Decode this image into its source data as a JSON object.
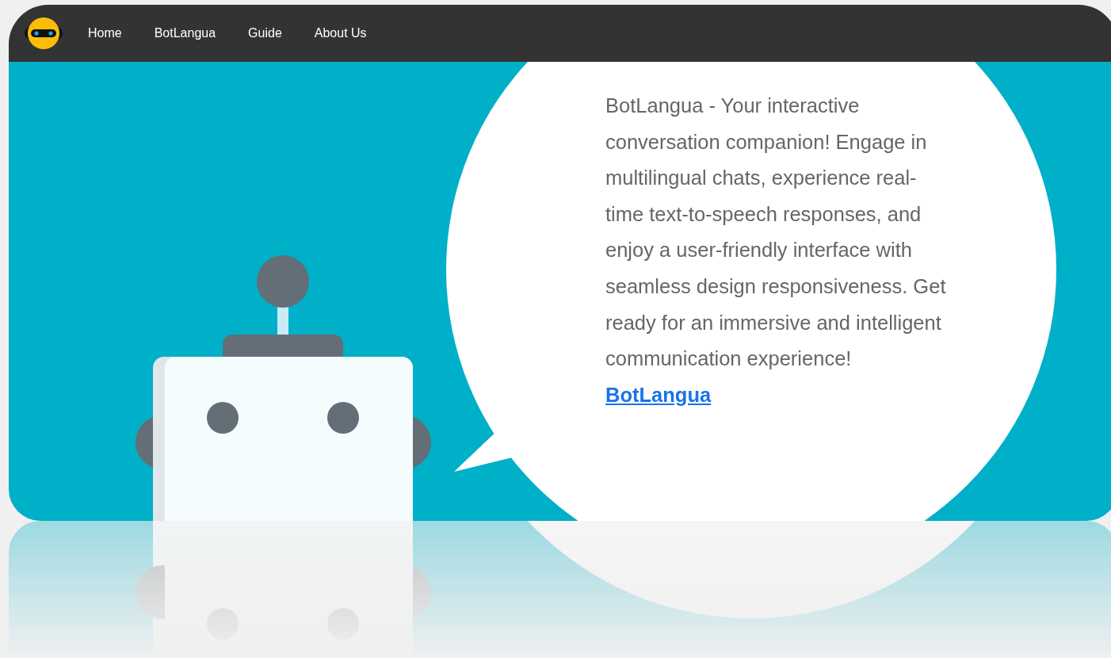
{
  "nav": {
    "links": [
      {
        "label": "Home"
      },
      {
        "label": "BotLangua"
      },
      {
        "label": "Guide"
      },
      {
        "label": "About Us"
      }
    ]
  },
  "hero": {
    "text": "BotLangua - Your interactive conversation companion! Engage in multilingual chats, experience real-time text-to-speech responses, and enjoy a user-friendly interface with seamless design responsiveness. Get ready for an immersive and intelligent communication experience!",
    "link": "BotLangua"
  }
}
